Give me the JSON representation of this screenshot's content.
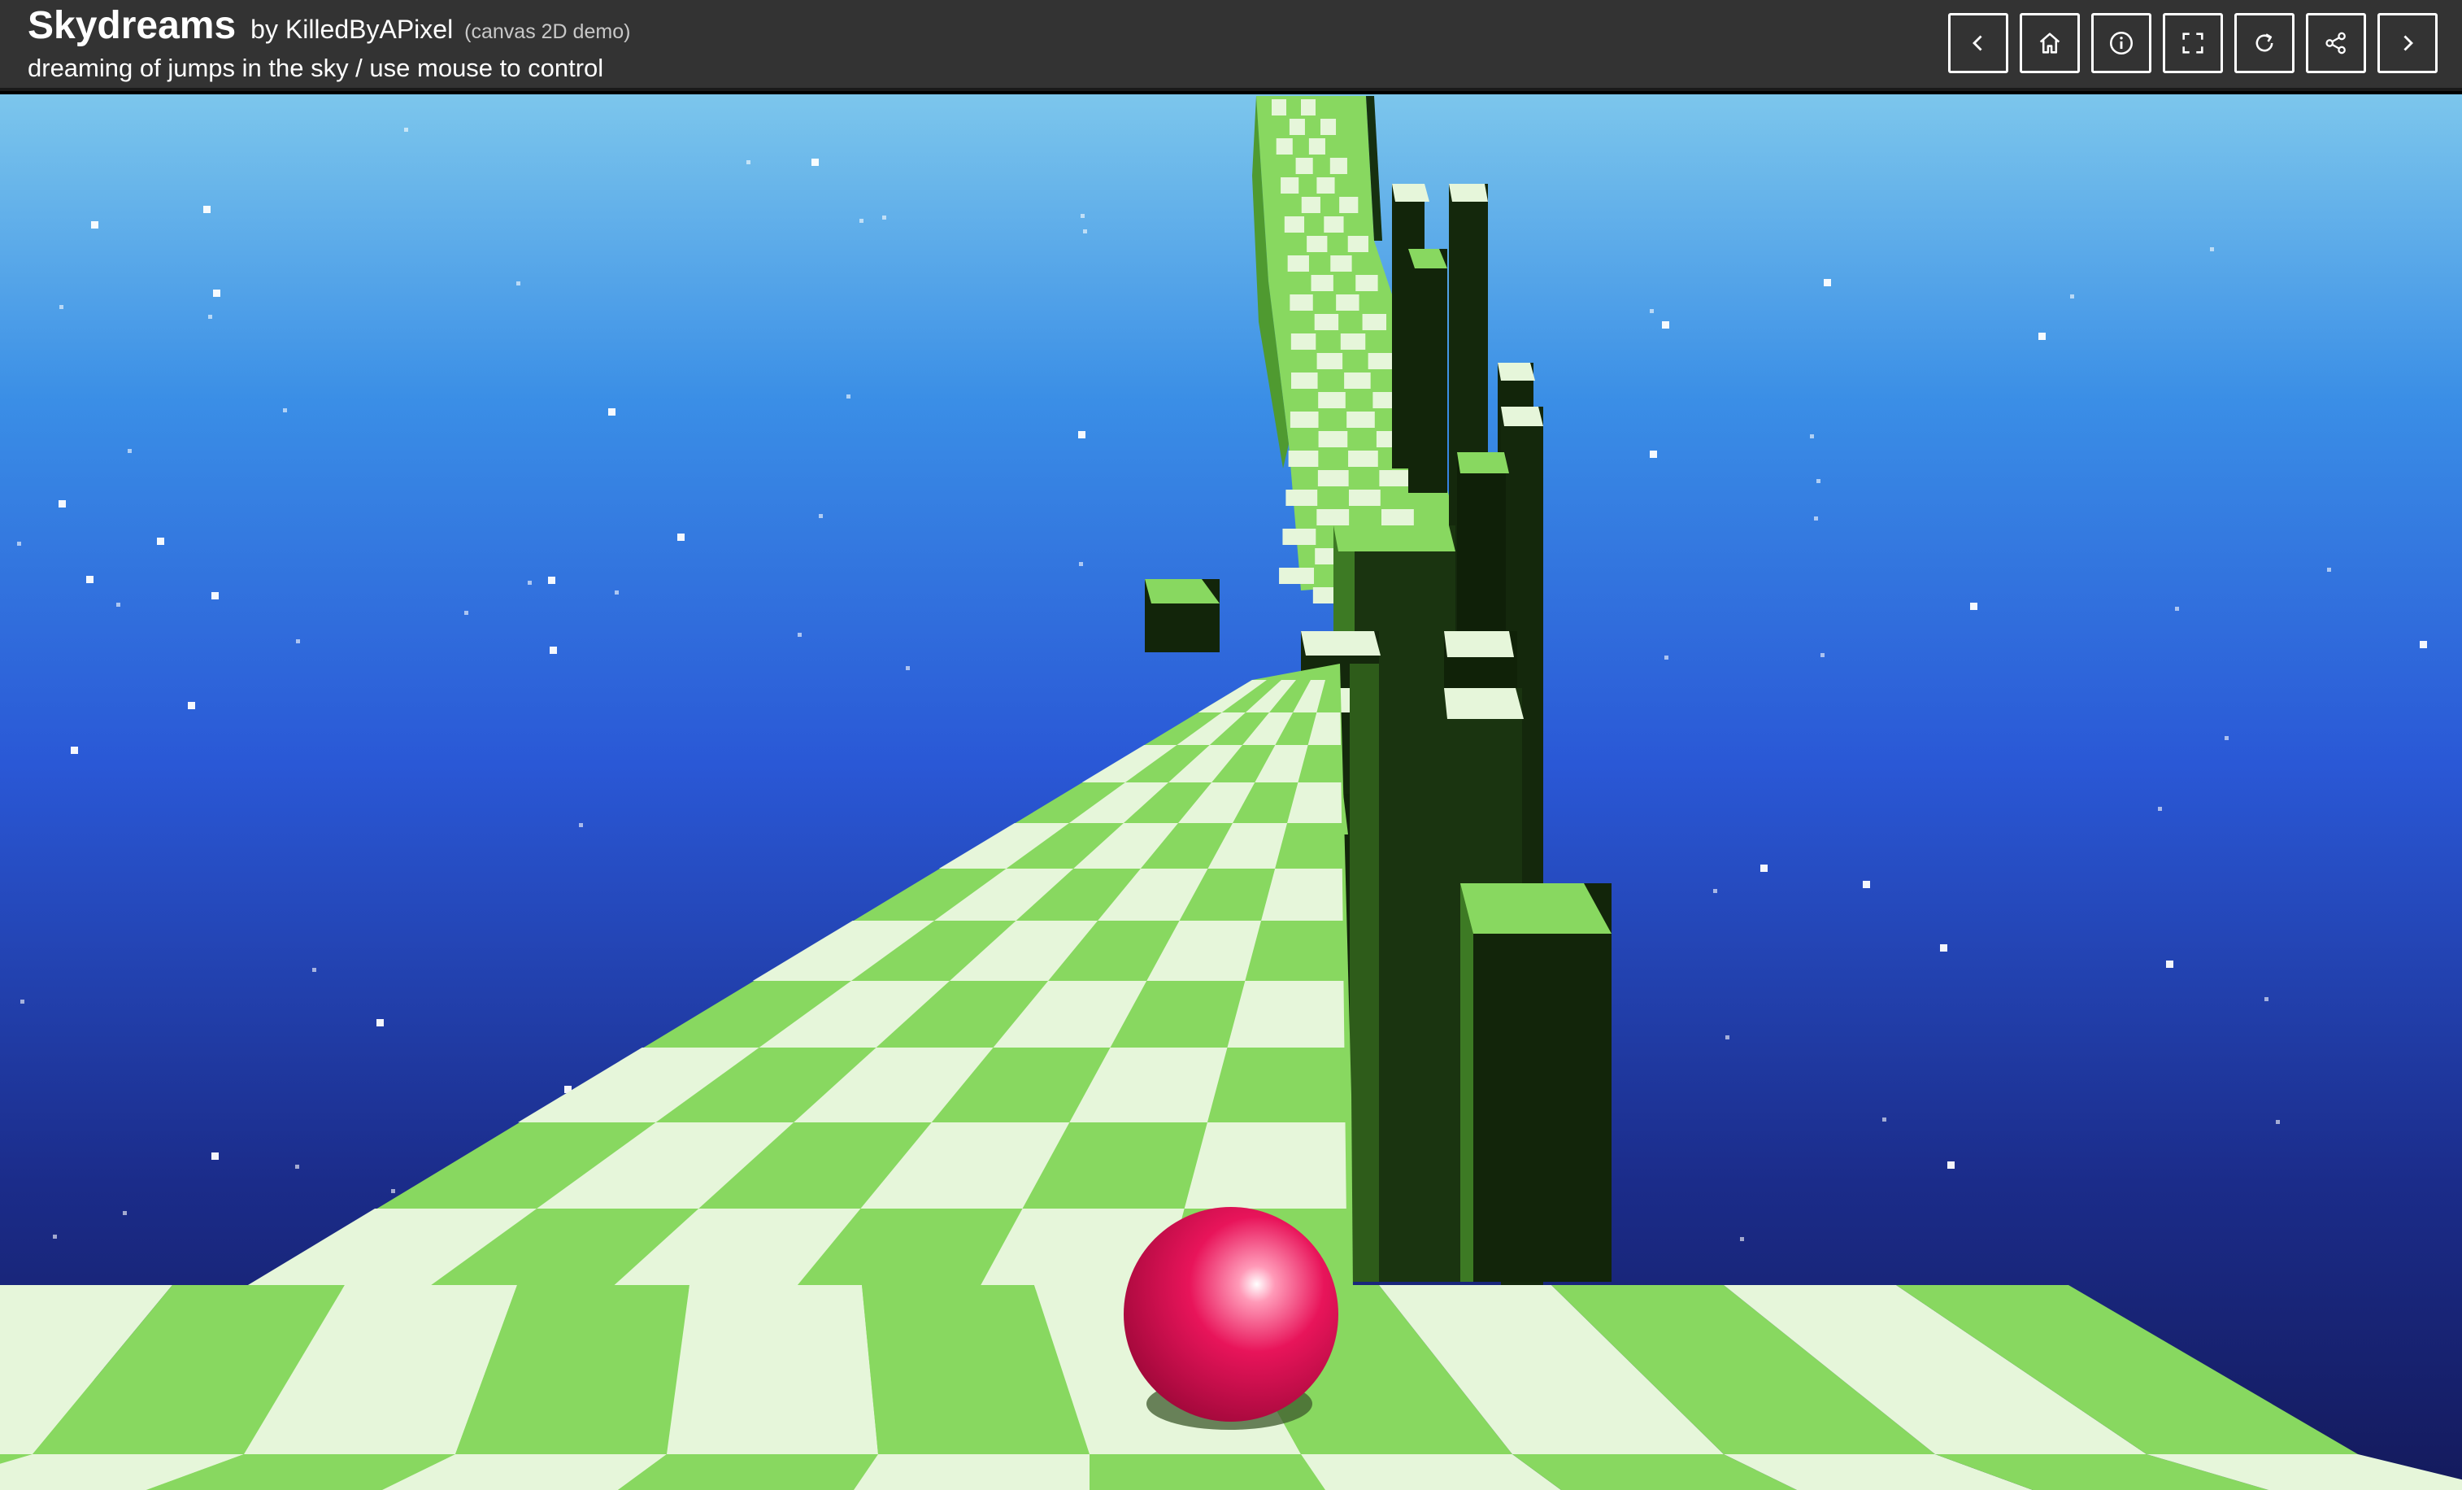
{
  "header": {
    "title": "Skydreams",
    "author": "by KilledByAPixel",
    "tag": "(canvas 2D demo)",
    "subtitle": "dreaming of jumps in the sky / use mouse to control"
  },
  "toolbar": [
    {
      "name": "prev-button",
      "icon": "chevron-left-icon"
    },
    {
      "name": "home-button",
      "icon": "home-icon"
    },
    {
      "name": "info-button",
      "icon": "info-icon"
    },
    {
      "name": "fullscreen-button",
      "icon": "fullscreen-icon"
    },
    {
      "name": "reload-button",
      "icon": "reload-icon"
    },
    {
      "name": "share-button",
      "icon": "share-icon"
    },
    {
      "name": "next-button",
      "icon": "chevron-right-icon"
    }
  ],
  "colors": {
    "header_bg": "#333333",
    "sky_top": "#7cc6ec",
    "sky_mid": "#2a58d6",
    "sky_bottom": "#141a5c",
    "tile_dark": "#88d860",
    "tile_light": "#e6f6da",
    "pillar_side": "#12250a",
    "ball": "#e0104e"
  }
}
